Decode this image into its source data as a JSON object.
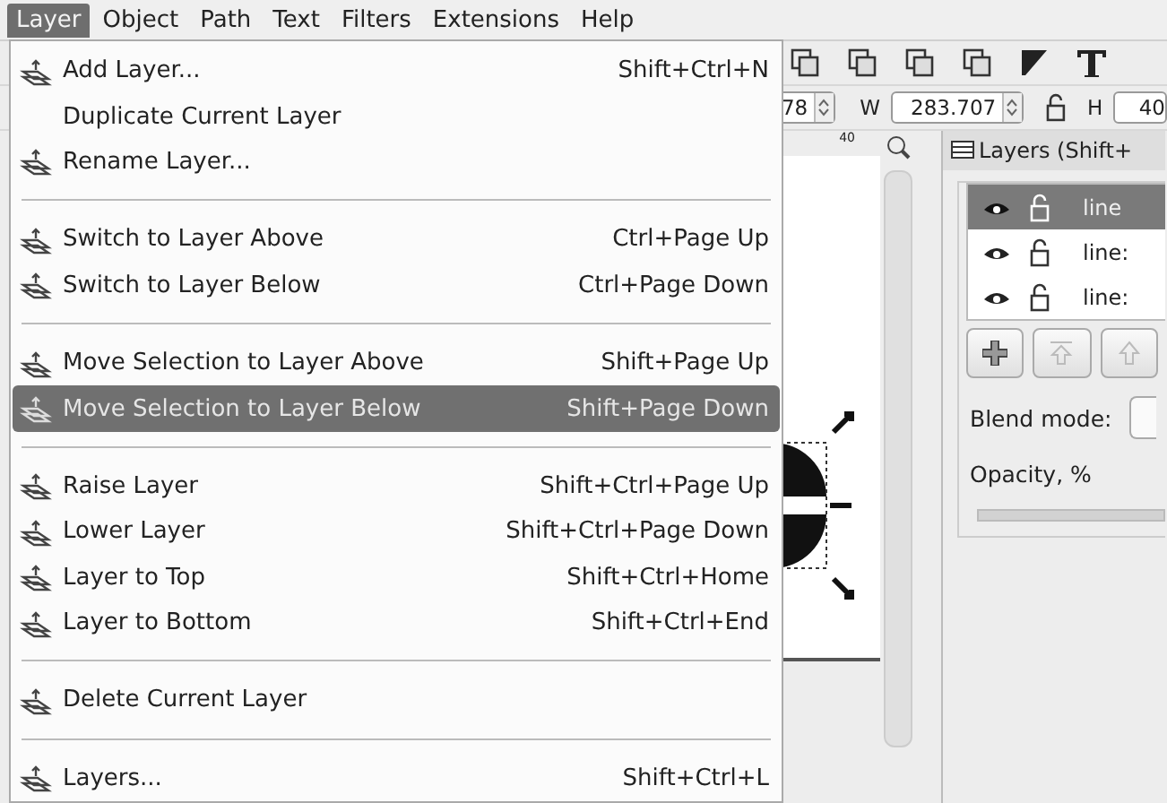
{
  "menubar": [
    {
      "label": "Layer",
      "selected": true
    },
    {
      "label": "Object",
      "selected": false
    },
    {
      "label": "Path",
      "selected": false
    },
    {
      "label": "Text",
      "selected": false
    },
    {
      "label": "Filters",
      "selected": false
    },
    {
      "label": "Extensions",
      "selected": false
    },
    {
      "label": "Help",
      "selected": false
    }
  ],
  "menu": [
    {
      "kind": "item",
      "label": "Add Layer...",
      "shortcut": "Shift+Ctrl+N",
      "has_icon": true,
      "selected": false
    },
    {
      "kind": "item",
      "label": "Duplicate Current Layer",
      "has_icon": false,
      "selected": false
    },
    {
      "kind": "item",
      "label": "Rename Layer...",
      "has_icon": true,
      "selected": false
    },
    {
      "kind": "separator"
    },
    {
      "kind": "item",
      "label": "Switch to Layer Above",
      "shortcut": "Ctrl+Page Up",
      "has_icon": true,
      "selected": false
    },
    {
      "kind": "item",
      "label": "Switch to Layer Below",
      "shortcut": "Ctrl+Page Down",
      "has_icon": true,
      "selected": false
    },
    {
      "kind": "separator"
    },
    {
      "kind": "item",
      "label": "Move Selection to Layer Above",
      "shortcut": "Shift+Page Up",
      "has_icon": true,
      "selected": false
    },
    {
      "kind": "item",
      "label": "Move Selection to Layer Below",
      "shortcut": "Shift+Page Down",
      "has_icon": true,
      "selected": true
    },
    {
      "kind": "separator"
    },
    {
      "kind": "item",
      "label": "Raise Layer",
      "shortcut": "Shift+Ctrl+Page Up",
      "has_icon": true,
      "selected": false
    },
    {
      "kind": "item",
      "label": "Lower Layer",
      "shortcut": "Shift+Ctrl+Page Down",
      "has_icon": true,
      "selected": false
    },
    {
      "kind": "item",
      "label": "Layer to Top",
      "shortcut": "Shift+Ctrl+Home",
      "has_icon": true,
      "selected": false
    },
    {
      "kind": "item",
      "label": "Layer to Bottom",
      "shortcut": "Shift+Ctrl+End",
      "has_icon": true,
      "selected": false
    },
    {
      "kind": "separator"
    },
    {
      "kind": "item",
      "label": "Delete Current Layer",
      "has_icon": true,
      "selected": false
    },
    {
      "kind": "separator"
    },
    {
      "kind": "item",
      "label": "Layers...",
      "shortcut": "Shift+Ctrl+L",
      "has_icon": true,
      "selected": false
    }
  ],
  "toolbar": {
    "x_value": "78",
    "w_label": "W",
    "w_value": "283.707",
    "h_label": "H",
    "h_value": "40"
  },
  "ruler": {
    "mark": "40"
  },
  "layers_panel": {
    "title": "Layers (Shift+",
    "rows": [
      {
        "name": "line",
        "selected": true
      },
      {
        "name": "line:",
        "selected": false
      },
      {
        "name": "line:",
        "selected": false
      }
    ],
    "blend_label": "Blend mode:",
    "opacity_label": "Opacity, %",
    "opacity_slider": {
      "level": 1
    }
  }
}
